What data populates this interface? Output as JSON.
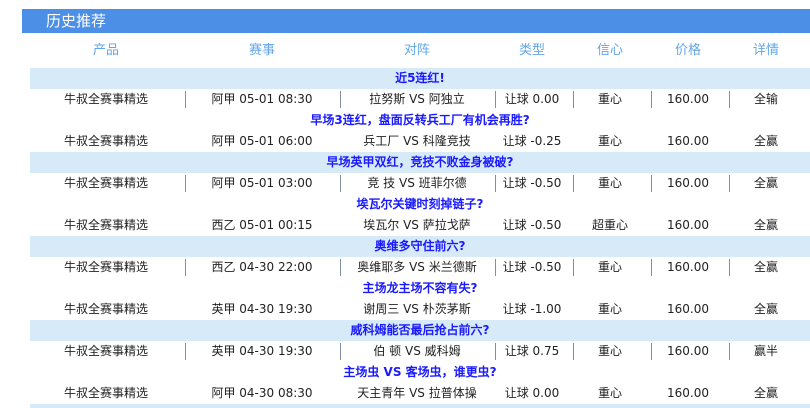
{
  "section_title": "历史推荐",
  "columns": [
    "产品",
    "赛事",
    "对阵",
    "类型",
    "信心",
    "价格",
    "详情"
  ],
  "rows": [
    {
      "headline": "近5连红!",
      "product": "牛叔全赛事精选",
      "event": "阿甲 05-01 08:30",
      "matchup": "拉努斯 VS 阿独立",
      "type": "让球 0.00",
      "confidence": "重心",
      "price": "160.00",
      "result": "全输"
    },
    {
      "headline": "早场3连红，盘面反转兵工厂有机会再胜?",
      "product": "牛叔全赛事精选",
      "event": "阿甲 05-01 06:00",
      "matchup": "兵工厂 VS 科隆竞技",
      "type": "让球 -0.25",
      "confidence": "重心",
      "price": "160.00",
      "result": "全赢"
    },
    {
      "headline": "早场英甲双红，竞技不败金身被破?",
      "product": "牛叔全赛事精选",
      "event": "阿甲 05-01 03:00",
      "matchup": "竞 技 VS 班菲尔德",
      "type": "让球 -0.50",
      "confidence": "重心",
      "price": "160.00",
      "result": "全赢"
    },
    {
      "headline": "埃瓦尔关键时刻掉链子?",
      "product": "牛叔全赛事精选",
      "event": "西乙 05-01 00:15",
      "matchup": "埃瓦尔 VS 萨拉戈萨",
      "type": "让球 -0.50",
      "confidence": "超重心",
      "price": "160.00",
      "result": "全赢"
    },
    {
      "headline": "奥维多守住前六?",
      "product": "牛叔全赛事精选",
      "event": "西乙 04-30 22:00",
      "matchup": "奥维耶多 VS 米兰德斯",
      "type": "让球 -0.50",
      "confidence": "重心",
      "price": "160.00",
      "result": "全赢"
    },
    {
      "headline": "主场龙主场不容有失?",
      "product": "牛叔全赛事精选",
      "event": "英甲 04-30 19:30",
      "matchup": "谢周三 VS 朴茨茅斯",
      "type": "让球 -1.00",
      "confidence": "重心",
      "price": "160.00",
      "result": "全赢"
    },
    {
      "headline": "威科姆能否最后抢占前六?",
      "product": "牛叔全赛事精选",
      "event": "英甲 04-30 19:30",
      "matchup": "伯 顿 VS 威科姆",
      "type": "让球 0.75",
      "confidence": "重心",
      "price": "160.00",
      "result": "赢半"
    },
    {
      "headline": "主场虫 VS 客场虫，谁更虫?",
      "product": "牛叔全赛事精选",
      "event": "阿甲 04-30 08:30",
      "matchup": "天主青年 VS 拉普体操",
      "type": "让球 0.00",
      "confidence": "重心",
      "price": "160.00",
      "result": "全赢"
    }
  ]
}
